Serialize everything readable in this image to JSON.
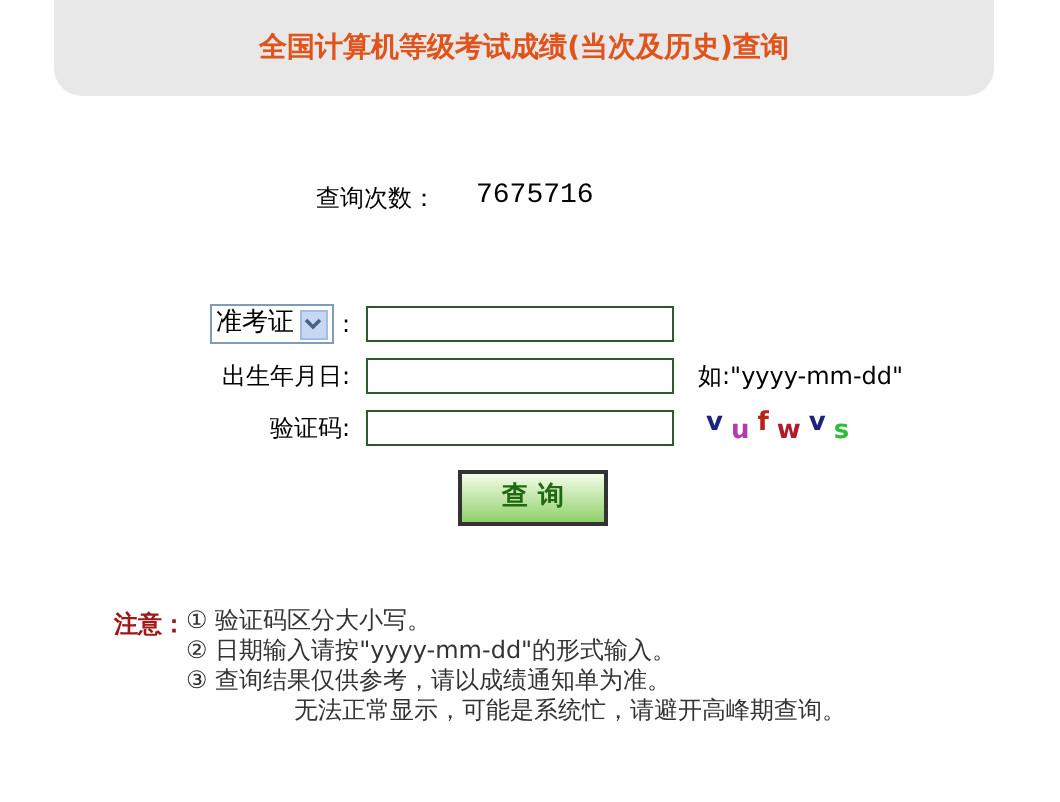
{
  "title": "全国计算机等级考试成绩(当次及历史)查询",
  "query_count": {
    "label": "查询次数：",
    "value": "7675716"
  },
  "form": {
    "id_type": {
      "value": "准考证",
      "suffix": ":"
    },
    "fields": [
      {
        "label": "出生年月日:",
        "hint": "如:\"yyyy-mm-dd\""
      },
      {
        "label": "验证码:"
      }
    ],
    "captcha": [
      {
        "char": "v",
        "color": "#1a237e"
      },
      {
        "char": "u",
        "color": "#b03cb0"
      },
      {
        "char": "f",
        "color": "#c0201a"
      },
      {
        "char": "w",
        "color": "#b01a2a"
      },
      {
        "char": "v",
        "color": "#1a237e"
      },
      {
        "char": "s",
        "color": "#2ebd3a"
      }
    ],
    "submit": "查 询"
  },
  "notes": {
    "label": "注意：",
    "items": [
      "① 验证码区分大小写。",
      "② 日期输入请按\"yyyy-mm-dd\"的形式输入。",
      "③ 查询结果仅供参考，请以成绩通知单为准。",
      "无法正常显示，可能是系统忙，请避开高峰期查询。"
    ]
  }
}
